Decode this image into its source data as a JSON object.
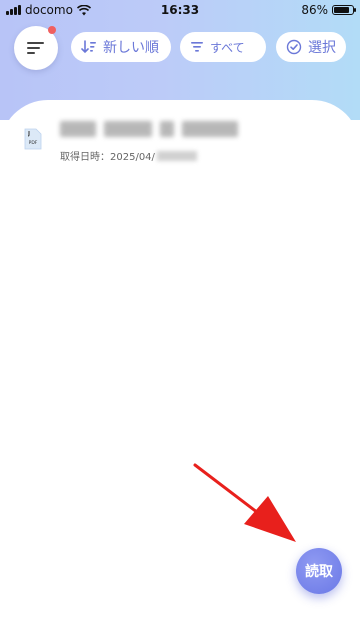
{
  "status_bar": {
    "carrier": "docomo",
    "time": "16:33",
    "battery_percent": "86%",
    "battery_level": 0.86
  },
  "toolbar": {
    "sort_label": "新しい順",
    "filter_label": "すべて",
    "select_label": "選択"
  },
  "files": [
    {
      "type_label": "PDF",
      "date_prefix": "取得日時：2025/04/"
    }
  ],
  "fab": {
    "label": "読取"
  },
  "colors": {
    "accent": "#6b78d8",
    "fab": "#6a78e6",
    "notification_dot": "#f06060",
    "annotation_arrow": "#e8201c"
  }
}
